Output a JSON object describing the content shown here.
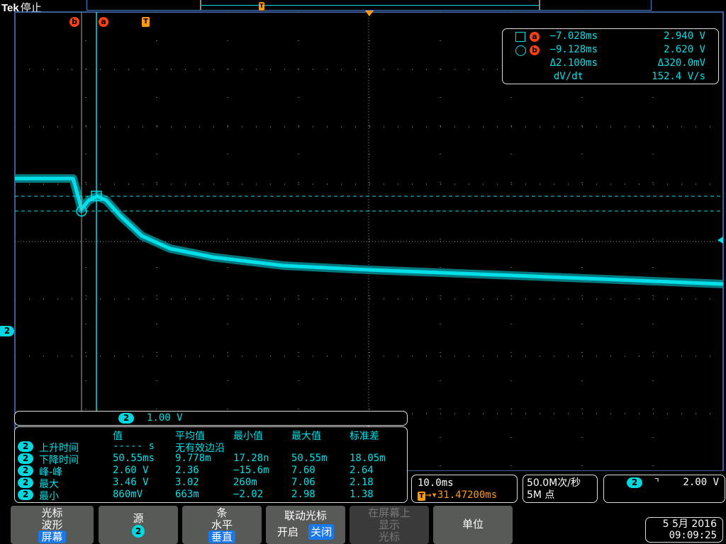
{
  "header": {
    "brand": "Tek",
    "status": "停止"
  },
  "markers": {
    "cursor_b": "b",
    "cursor_a": "a",
    "trigger": "T",
    "ground": "2"
  },
  "cursor_readout": {
    "a": {
      "time": "−7.028ms",
      "value": "2.940 V"
    },
    "b": {
      "time": "−9.128ms",
      "value": "2.620 V"
    },
    "delta": {
      "time": "Δ2.100ms",
      "value": "Δ320.0mV"
    },
    "rate": {
      "label": "dV/dt",
      "value": "152.4 V/s"
    }
  },
  "channel_scale": {
    "channel": "2",
    "value": "1.00 V"
  },
  "measurements": {
    "headers": [
      "值",
      "平均值",
      "最小值",
      "最大值",
      "标准差"
    ],
    "rows": [
      {
        "ch": "2",
        "name": "上升时间",
        "value": "----- s",
        "mean": "无有效边沿",
        "min": "",
        "max": "",
        "std": ""
      },
      {
        "ch": "2",
        "name": "下降时间",
        "value": "50.55ms",
        "mean": "9.778m",
        "min": "17.28n",
        "max": "50.55m",
        "std": "18.05m"
      },
      {
        "ch": "2",
        "name": "峰-峰",
        "value": "2.60 V",
        "mean": "2.36",
        "min": "−15.6m",
        "max": "7.60",
        "std": "2.64"
      },
      {
        "ch": "2",
        "name": "最大",
        "value": "3.46 V",
        "mean": "3.02",
        "min": "260m",
        "max": "7.06",
        "std": "2.18"
      },
      {
        "ch": "2",
        "name": "最小",
        "value": "860mV",
        "mean": "663m",
        "min": "−2.02",
        "max": "2.98",
        "std": "1.38"
      }
    ]
  },
  "horizontal": {
    "scale": "10.0ms",
    "position": "31.47200ms"
  },
  "acquisition": {
    "rate": "50.0M次/秒",
    "points": "5M 点"
  },
  "trigger": {
    "channel": "2",
    "slope": "falling",
    "level": "2.00 V"
  },
  "menu": {
    "b1": {
      "l1": "光标",
      "l2": "波形",
      "sel": "屏幕"
    },
    "b2": {
      "l1": "源",
      "sel": "2"
    },
    "b3": {
      "l1": "条",
      "l2": "水平",
      "sel": "垂直"
    },
    "b4": {
      "l1": "联动光标",
      "on": "开启",
      "off": "关闭"
    },
    "b5": {
      "l1": "在屏幕上",
      "l2": "显示",
      "l3": "光标"
    },
    "b6": {
      "l1": "单位"
    }
  },
  "datetime": {
    "date": "5 5月  2016",
    "time": "09:09:25"
  },
  "colors": {
    "trace": "#00e0e8",
    "cursor_marker": "#ff4010",
    "trigger": "#ff9a10",
    "selected": "#1a78e8"
  }
}
